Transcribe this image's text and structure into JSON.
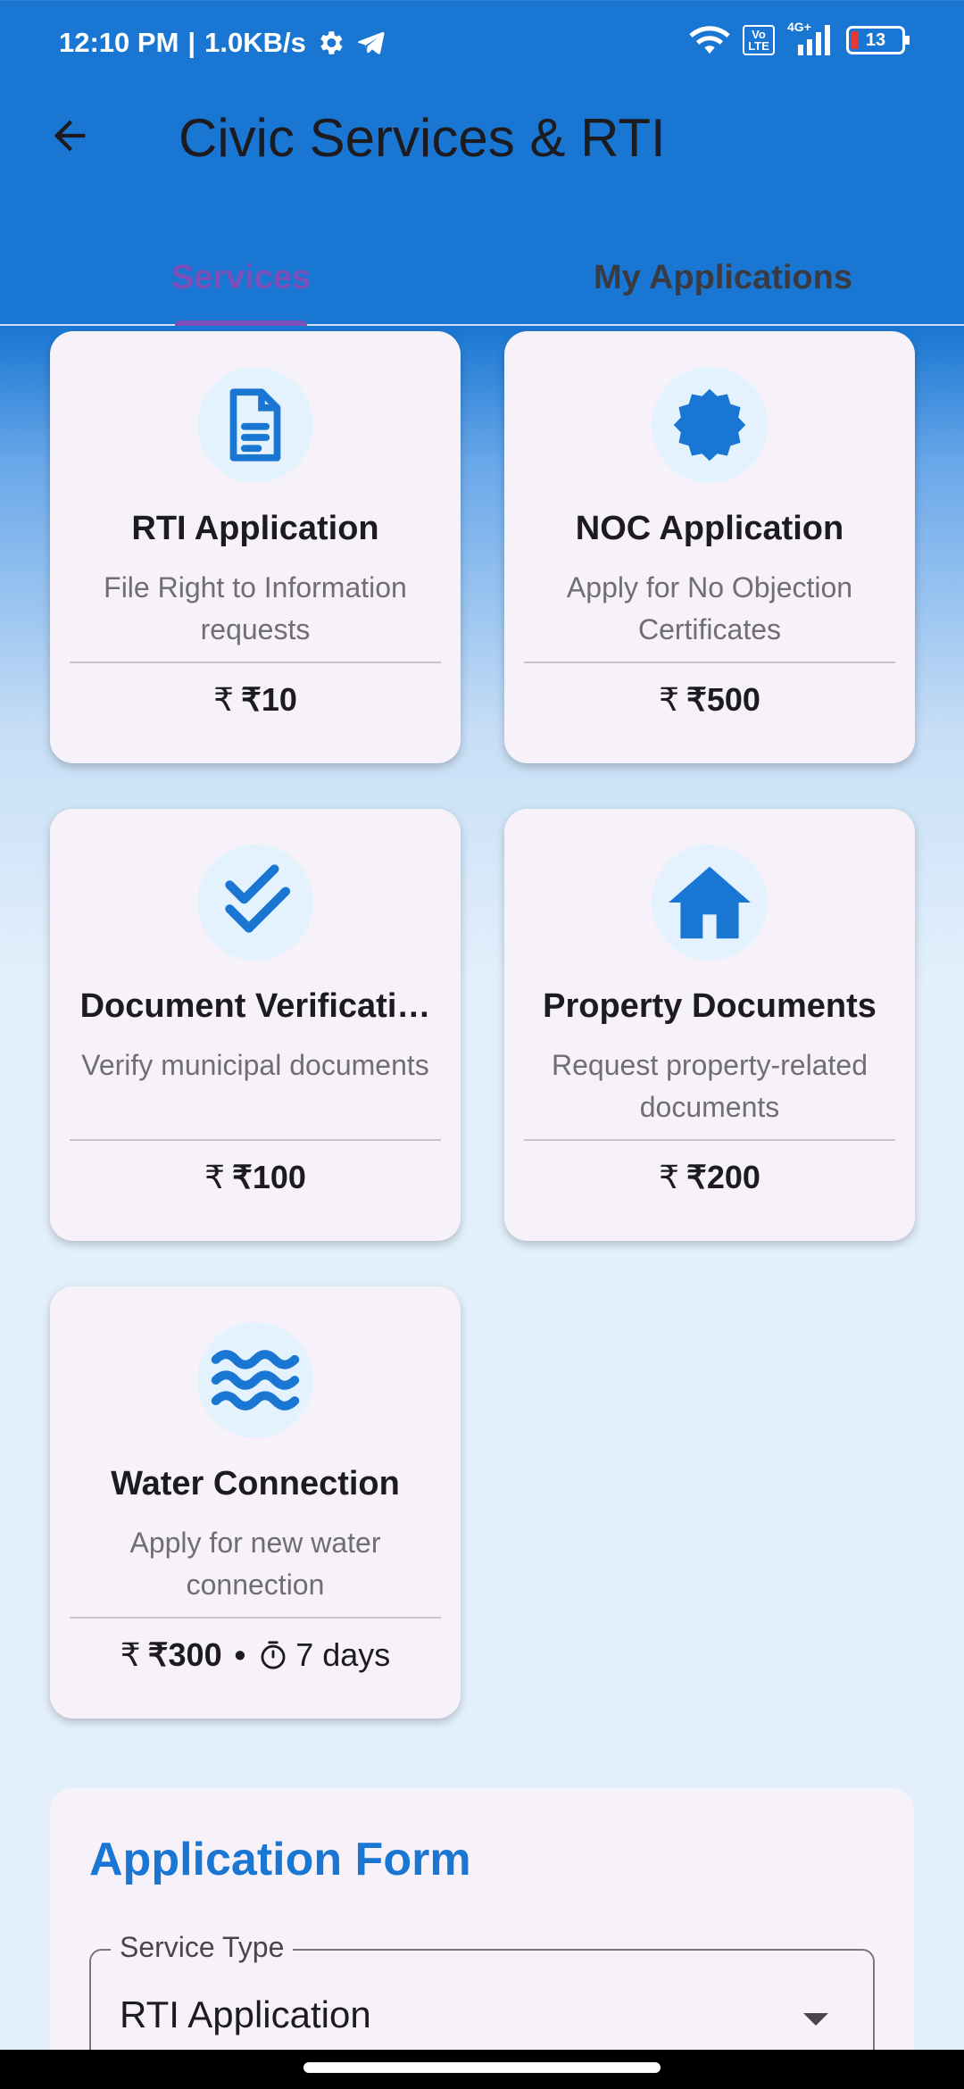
{
  "status_bar": {
    "time": "12:10 PM",
    "separator": "|",
    "speed": "1.0KB/s",
    "volte_text": "Vo LTE",
    "network": "4G+",
    "battery": "13",
    "icons": [
      "gear-icon",
      "telegram-icon",
      "wifi-icon",
      "volte-icon",
      "signal-icon",
      "battery-icon"
    ]
  },
  "app_bar": {
    "title": "Civic Services & RTI",
    "back_icon": "arrow-back-icon"
  },
  "tabs": [
    {
      "label": "Services",
      "active": true
    },
    {
      "label": "My Applications",
      "active": false
    }
  ],
  "services": [
    {
      "title": "RTI Application",
      "description": "File Right to Information requests",
      "price": "₹10",
      "icon": "document-icon"
    },
    {
      "title": "NOC Application",
      "description": "Apply for No Objection Certificates",
      "price": "₹500",
      "icon": "badge-icon"
    },
    {
      "title": "Document Verificati…",
      "description": "Verify municipal documents",
      "price": "₹100",
      "icon": "double-check-icon"
    },
    {
      "title": "Property Documents",
      "description": "Request property-related documents",
      "price": "₹200",
      "icon": "home-icon"
    },
    {
      "title": "Water Connection",
      "description": "Apply for new water connection",
      "price": "₹300",
      "duration": "7 days",
      "icon": "water-icon"
    }
  ],
  "currency_icon_symbol": "₹",
  "bullet": "•",
  "form": {
    "title": "Application Form",
    "service_type_label": "Service Type",
    "service_type_value": "RTI Application"
  },
  "colors": {
    "primary": "#1976d2",
    "tab_active": "#7e4fb8",
    "card_bg": "#f7f2f9",
    "icon_circle": "#e3f2fd"
  }
}
